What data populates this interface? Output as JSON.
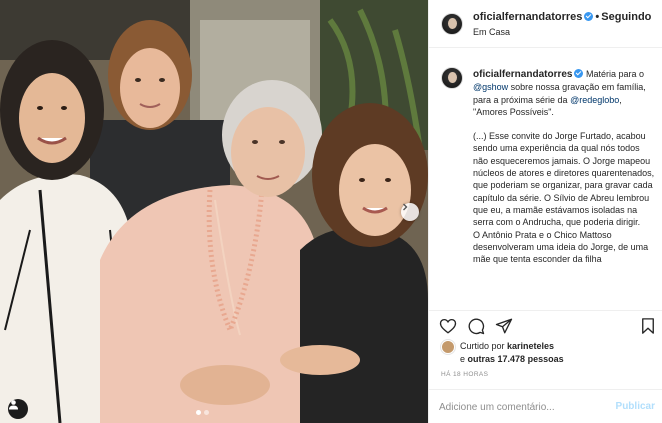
{
  "header": {
    "username": "oficialfernandatorres",
    "follow_state": "Seguindo",
    "location": "Em Casa"
  },
  "caption": {
    "username": "oficialfernandatorres",
    "intro_before": "Matéria para o ",
    "mention_gshow": "@gshow",
    "intro_middle": " sobre nossa gravação em família, para a próxima série da ",
    "mention_redeglobo": "@redeglobo",
    "intro_after": ", \"Amores Possíveis\".",
    "body_1": "(...) Esse convite do Jorge Furtado, acabou sendo uma experiência da qual nós todos não esqueceremos jamais. O Jorge mapeou núcleos de atores e diretores quarentenados, que poderiam se organizar, para gravar cada capítulo da série. O Sílvio de Abreu lembrou que eu, a mamãe estávamos isoladas na serra com o Andrucha, que poderia dirigir.",
    "body_2": "O Antônio Prata e o Chico Mattoso desenvolveram uma ideia do Jorge, de uma mãe que tenta esconder da filha"
  },
  "likes": {
    "prefix": "Curtido por ",
    "first_user": "karineteles",
    "and_others": "outras 17.478 pessoas",
    "joiner": " e"
  },
  "timestamp": "HÁ 18 HORAS",
  "comment": {
    "placeholder": "Adicione um comentário...",
    "post_label": "Publicar"
  },
  "colors": {
    "verified": "#3897f0",
    "post_disabled": "#b2dffc",
    "mention": "#00376b",
    "meta": "#8e8e8e"
  },
  "icons": [
    "heart-icon",
    "comment-icon",
    "share-icon",
    "bookmark-icon",
    "verified-icon",
    "chevron-right-icon",
    "user-tag-icon"
  ]
}
